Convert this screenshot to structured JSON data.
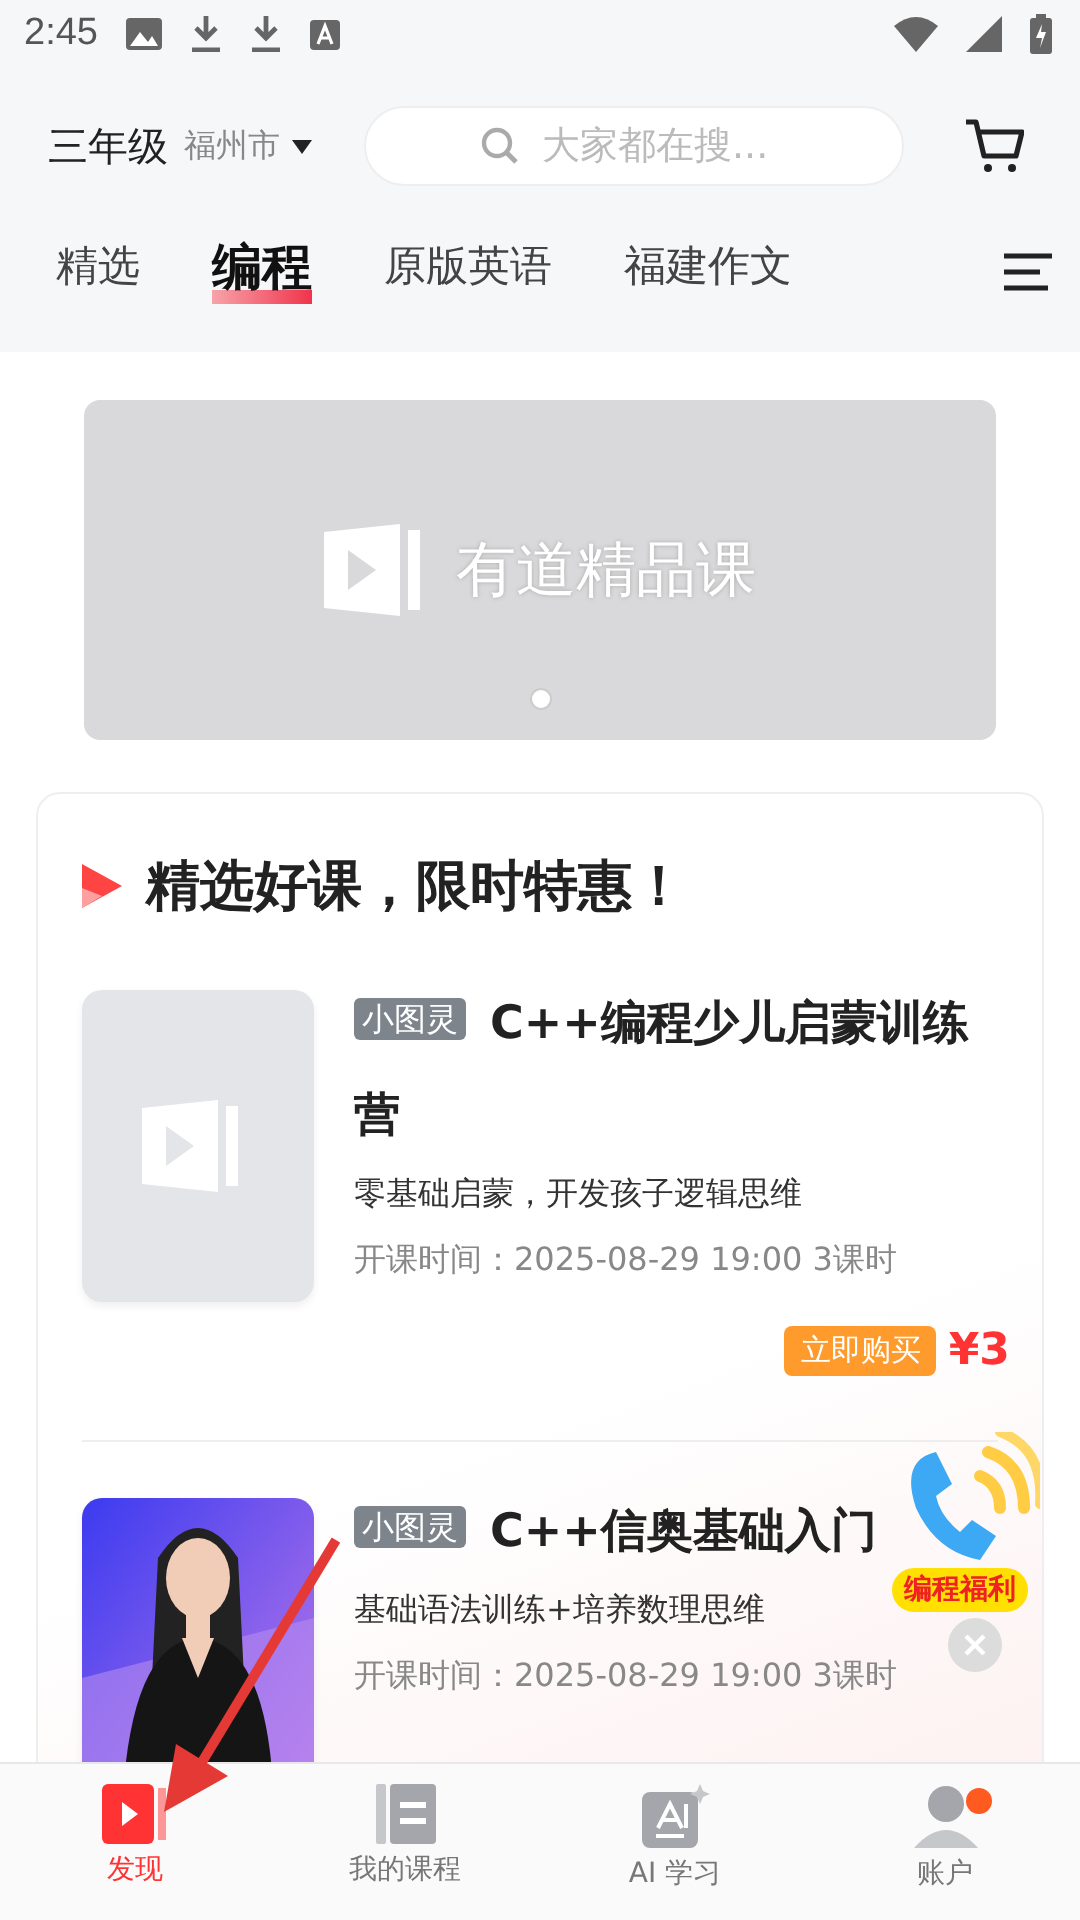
{
  "status_bar": {
    "time": "2:45"
  },
  "header": {
    "grade": "三年级",
    "city": "福州市",
    "search": {
      "placeholder": "大家都在搜..."
    }
  },
  "tabs": [
    {
      "label": "精选",
      "selected": false
    },
    {
      "label": "编程",
      "selected": true
    },
    {
      "label": "原版英语",
      "selected": false
    },
    {
      "label": "福建作文",
      "selected": false
    }
  ],
  "banner": {
    "logo_text": "有道精品课",
    "dots": [
      {
        "selected": true
      }
    ]
  },
  "section": {
    "title": "精选好课，限时特惠！",
    "courses": [
      {
        "kind": "placeholder",
        "tag": "小图灵",
        "title": "C++编程少儿启蒙训练营",
        "subtitle": "零基础启蒙，开发孩子逻辑思维",
        "meta": "开课时间：2025-08-29 19:00 3课时",
        "buy": "立即购买",
        "price": "¥3"
      },
      {
        "kind": "picture",
        "tag": "小图灵",
        "title": "C++信奥基础入门",
        "subtitle": "基础语法训练+培养数理思维",
        "meta": "开课时间：2025-08-29 19:00 3课时"
      }
    ]
  },
  "float_widget": {
    "label": "编程福利"
  },
  "bottom_nav": [
    {
      "label": "发现",
      "selected": true,
      "kind": "discover",
      "badge": false
    },
    {
      "label": "我的课程",
      "selected": false,
      "kind": "courses",
      "badge": false
    },
    {
      "label": "AI 学习",
      "selected": false,
      "kind": "ai",
      "badge": false
    },
    {
      "label": "账户",
      "selected": false,
      "kind": "account",
      "badge": true
    }
  ]
}
